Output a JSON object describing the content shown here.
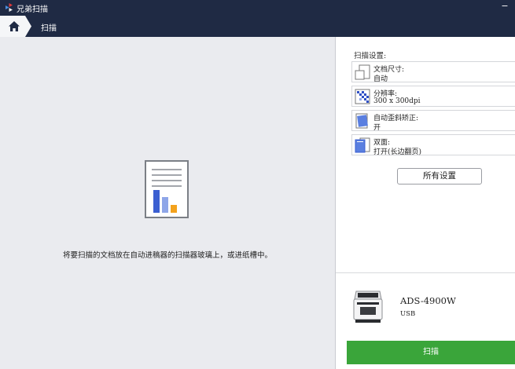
{
  "window": {
    "title": "兄弟扫描",
    "minimize_glyph": "−"
  },
  "nav": {
    "home_icon": "home-icon",
    "breadcrumb": "扫描"
  },
  "preview": {
    "hint": "将要扫描的文档放在自动进稿器的扫描器玻璃上，或进纸槽中。"
  },
  "settings_panel": {
    "title": "扫描设置:",
    "items": [
      {
        "label": "文档尺寸:",
        "value": "自动",
        "icon": "document-size-icon"
      },
      {
        "label": "分辨率:",
        "value": "300 x 300dpi",
        "icon": "resolution-icon"
      },
      {
        "label": "自动歪斜矫正:",
        "value": "开",
        "icon": "deskew-icon"
      },
      {
        "label": "双面:",
        "value": "打开(长边翻页)",
        "icon": "duplex-icon"
      }
    ],
    "all_settings_label": "所有设置"
  },
  "device": {
    "model": "ADS-4900W",
    "connection": "USB"
  },
  "actions": {
    "scan_label": "扫描"
  },
  "colors": {
    "header_bg": "#1f2a44",
    "scan_button": "#3aa53a",
    "preview_bg": "#eaebef"
  }
}
